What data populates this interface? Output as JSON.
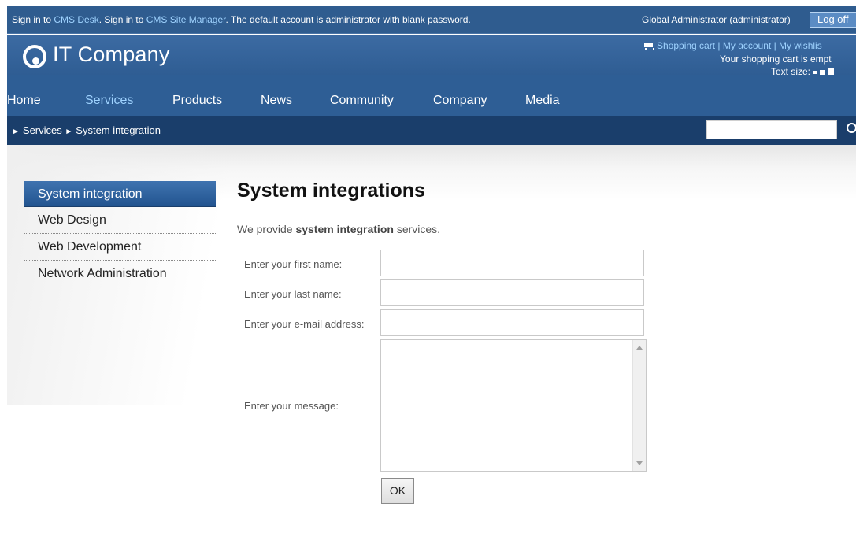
{
  "topbar": {
    "signin_prefix": "Sign in to ",
    "cms_desk_link": "CMS Desk",
    "signin_middle": ". Sign in to ",
    "site_manager_link": "CMS Site Manager",
    "signin_suffix": ". The default account is administrator with blank password.",
    "user": "Global Administrator (administrator)",
    "logoff": "Log off"
  },
  "header": {
    "logo_text": "IT Company",
    "shopping_cart": "Shopping cart",
    "my_account": "My account",
    "my_wishlist": "My wishlis",
    "separator": "|",
    "cart_status": "Your shopping cart is empt",
    "text_size_label": "Text size:"
  },
  "menu": {
    "items": [
      {
        "label": "Home"
      },
      {
        "label": "Services"
      },
      {
        "label": "Products"
      },
      {
        "label": "News"
      },
      {
        "label": "Community"
      },
      {
        "label": "Company"
      },
      {
        "label": "Media"
      }
    ],
    "active": "Services"
  },
  "breadcrumb": {
    "items": [
      "Services",
      "System integration"
    ],
    "arrow": "►",
    "search_value": ""
  },
  "leftnav": {
    "items": [
      {
        "label": "System integration"
      },
      {
        "label": "Web Design"
      },
      {
        "label": "Web Development"
      },
      {
        "label": "Network Administration"
      }
    ],
    "active": "System integration"
  },
  "main": {
    "title": "System integrations",
    "intro_prefix": "We provide ",
    "intro_bold": "system integration",
    "intro_suffix": " services."
  },
  "form": {
    "first_name_label": "Enter your first name:",
    "last_name_label": "Enter your last name:",
    "email_label": "Enter your e-mail address:",
    "message_label": "Enter your message:",
    "first_name_value": "",
    "last_name_value": "",
    "email_value": "",
    "message_value": "",
    "submit_label": "OK"
  },
  "colors": {
    "header_blue": "#2f5c8f",
    "crumb_navy": "#1a3e6b",
    "link_light_blue": "#9fd3ff",
    "active_nav_blue": "#2e63a3"
  }
}
